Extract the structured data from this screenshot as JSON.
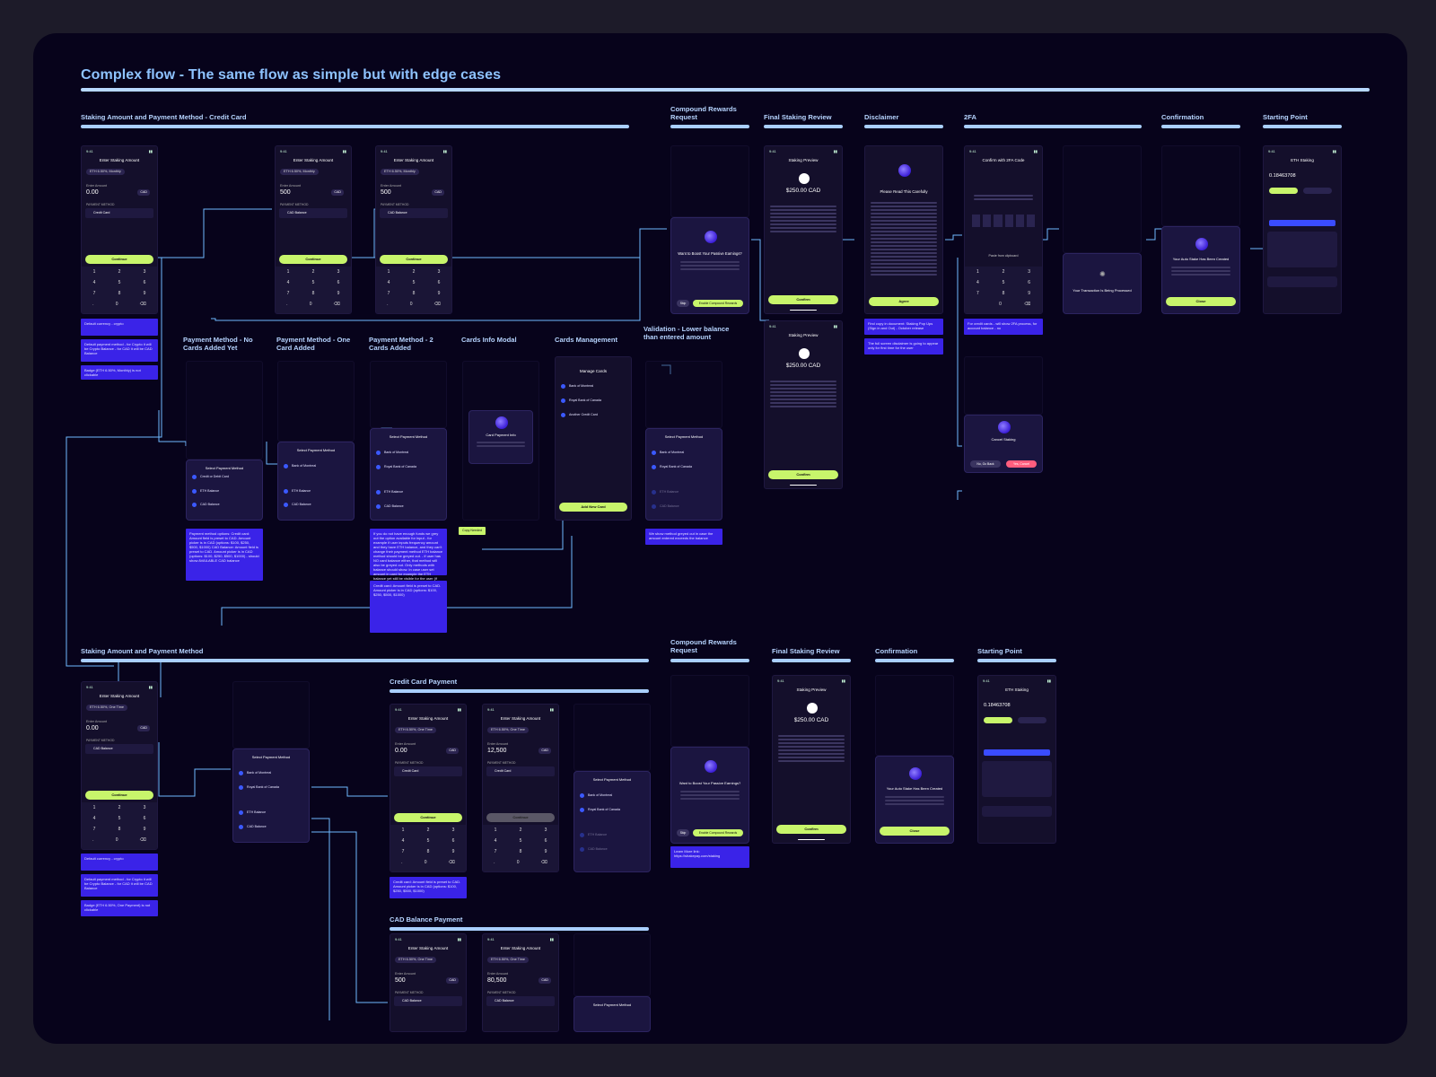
{
  "title": "Complex flow - The same flow as simple but with edge cases",
  "sections_top": {
    "staking_cc": "Staking Amount and Payment Method - Credit Card",
    "compound": "Compound Rewards Request",
    "final_review": "Final Staking Review",
    "disclaimer": "Disclaimer",
    "twofa": "2FA",
    "confirmation": "Confirmation",
    "starting_point": "Starting Point"
  },
  "sections_mid": {
    "no_cards": "Payment Method - No Cards Added Yet",
    "one_card": "Payment Method - One Card Added",
    "two_cards": "Payment Method - 2 Cards Added",
    "cards_info": "Cards Info Modal",
    "cards_mgmt": "Cards Management",
    "validation": "Validation - Lower balance than entered amount"
  },
  "sections_bottom": {
    "staking_pm": "Staking Amount and Payment Method",
    "compound": "Compound Rewards Request",
    "final_review": "Final Staking Review",
    "confirmation": "Confirmation",
    "starting_point": "Starting Point",
    "credit_card_payment": "Credit Card Payment",
    "cad_balance_payment": "CAD Balance Payment"
  },
  "phone": {
    "time": "9:41",
    "enter_amount_title": "Enter Staking Amount",
    "chip_monthly": "ETH 6.50%, Monthly",
    "chip_onetime": "ETH 6.50%, One Time",
    "enter_amount": "Enter Amount",
    "amt_zero": "0.00",
    "amt_500": "500",
    "amt_12500": "12,500",
    "amt_80500": "80,500",
    "cur": "CAD",
    "payment_method": "PAYMENT METHOD",
    "credit_card": "Credit Card",
    "cad_balance": "CAD Balance",
    "continue": "Continue",
    "staking_preview": "Staking Preview",
    "preview_amount": "$250.00 CAD",
    "confirm": "Confirm",
    "please_read": "Please Read This Carefully",
    "agree": "Agree",
    "confirm_2fa": "Confirm with 2FA Code",
    "paste": "Paste from clipboard",
    "processing": "Your Transaction Is Being Processed",
    "created": "Your Auto Stake Has Been Created",
    "close": "Close",
    "eth_staking": "ETH Staking",
    "eth_value": "0.18463708",
    "boost": "Want to Boost Your Passive Earnings?",
    "enable": "Enable Compound Rewards",
    "skip": "Skip",
    "select_pm": "Select Payment Method",
    "manage_cards": "Manage Cards",
    "bank_montreal": "Bank of Montreal",
    "royal_bank": "Royal Bank of Canada",
    "another_card": "Another Credit Card",
    "credit_debit": "Credit or Debit Card",
    "eth_balance": "ETH Balance",
    "card_payment_info": "Card Payment Info",
    "add_card": "Add New Card",
    "copy_needed": "Copy Needed",
    "cancel_staking": "Cancel Staking",
    "no_go_back": "No, Go Back",
    "yes_cancel": "Yes, Cancel"
  },
  "notes": {
    "n1": "Default currency - crypto",
    "n2": "Default payment method - for Crypto it will be Crypto Balance - for CAD it will be CAD Balance",
    "n3": "Badge (ETH 6.50%, Monthly) is not clickable",
    "n4": "Payment method options: Credit card: Amount field is preset to CAD. Amount picker is in CAD (options: $100, $250, $500, $1000) CAD Balance: Amount field is preset to CAD. Amount picker is in CAD (options: $100, $250, $500, $1000) - should show AVAILABLE CAD balance",
    "n5": "If you do not have enough funds we grey out the option available for input - for example if user inputs frequency amount and they have ETH balance, and they can't change their payment method ETH balance method should be greyed out. - if user has NO card balance either, that method will also be greyed out. Only methods with balance should show. In case user set amount in card for example the ETH balance yet still be visible for the user (if there's a balance there) - if user selects in the amount will be changed to ETH and reset to 0. Example: when user set amount in ETH and ETH balance is 0, we show active CAD balance (if there's any) and card option to stake ETH will be greyed out",
    "n6": "We show method greyed out in case the amount entered exceeds the balance",
    "n7": "Find copy in document: Staking Pop Ups (Sign in and Out) - October release",
    "n8": "The full screen disclaimer is going to appear only for first time for the user",
    "n9": "For credit cards - will show 2FA process, for account balance - no",
    "n10": "Credit card: Amount field is preset to CAD. Amount picker is in CAD (options: $100, $250, $500, $1000)",
    "n11": "Learn More link: https://shakepay.com/staking",
    "n12": "Default currency - crypto",
    "n13": "Default payment method - for Crypto it will be Crypto Balance - for CAD it will be CAD Balance",
    "n14": "Badge (ETH 6.50%, One Payment) is not clickable"
  },
  "colors": {
    "board": "#07031b",
    "accent": "#c8f56b",
    "note": "#3a23e8",
    "wire": "#7cc3ff"
  }
}
